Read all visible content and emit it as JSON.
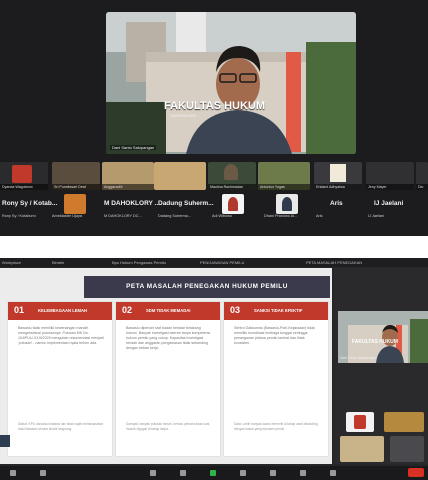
{
  "main_speaker": {
    "sign_text": "FAKULTAS HUKUM",
    "sign_sub": "UNIVERSITAS ...",
    "name_tag": "Dani Santo Salopangan"
  },
  "thumbnails_row1": [
    "Dyanda Wagutomo",
    "Sri Purwitasari Dewi",
    "Anggaradhi",
    "Maulina Rachmadan",
    "Antonius Yogas",
    "Eridami Adhyaksa",
    "Jeny Mayer",
    "Dio"
  ],
  "thumbnails_row2": [
    {
      "name": "Rony Sy / Kotab...",
      "sub": "Rony Sy / Kotabumi"
    },
    {
      "name": "",
      "sub": "Ameldaster Ujaya"
    },
    {
      "name": "M DAHOKLORY ...",
      "sub": "M DAHOKLORY DC..."
    },
    {
      "name": "Dadung Suherm...",
      "sub": "Dadang Suherma..."
    },
    {
      "name": "",
      "sub": "Adi Wibowo"
    },
    {
      "name": "",
      "sub": "Dhani Pranowo Al..."
    },
    {
      "name": "Aris",
      "sub": "Aris"
    },
    {
      "name": "IJ Jaelani",
      "sub": "IJ Jaelani"
    }
  ],
  "browser_tabs": [
    "Workplace",
    "Bimtek",
    "Bps Hukum Pengawas Pemilu",
    "PENGAWASAN PEMILU",
    "PETA MASALAH PENEGAKAN"
  ],
  "slide": {
    "title": "PETA MASALAH PENEGAKAN HUKUM PEMILU",
    "cards": [
      {
        "num": "01",
        "title": "KELEMBAGAAN LEMAH",
        "body": "Bawaslu tidak memiliki kewenangan mandiri mengeksekusi putusannya. Putusan MK No. 104/PUU-XXIII/2025 mengubah rekomendasi menjadi 'putusan' - namun implementasi nyata belum ada.",
        "foot": "Akibat: KPU dan/atau instansi lain tidak wajib melaksanakan hasil Bawaslu secara tindak langsung."
      },
      {
        "num": "02",
        "title": "SDM TIDAK MEMADAI",
        "body": "Bawaslu dipenuhi staf badan berlatar belakang hukum. Banyak investigasi daerah tanpa kompetensi hukum pemilu yang cukup. Kapasitas investigasi rendah dan anggaran pengawasan tidak sebanding dengan beban kerja.",
        "foot": "Dampak: banyak putusan lemah, berkas perkara tidak kuat, mudah digugat di tahap lanjut."
      },
      {
        "num": "03",
        "title": "SANKSI TIDAK EFEKTIF",
        "body": "Sentra Gakkumdu (Bawaslu-Polri-Kejaksaan) tidak memiliki koordinasi lembaga tunggal sehingga penanganan pidana pemilu lambat dan tidak konsisten.",
        "foot": "Data: Lebih banyak kasus berhenti di tahap awal dibanding dengan kasus yang diproses penuh."
      }
    ]
  },
  "side_panel": {
    "name_tag": "Dani Santo Salopangan",
    "sign_text": "FAKULTAS HUKUM"
  },
  "colors": {
    "accent_red": "#c0392b",
    "slide_header": "#3a3a4c",
    "leave_red": "#d93025"
  }
}
